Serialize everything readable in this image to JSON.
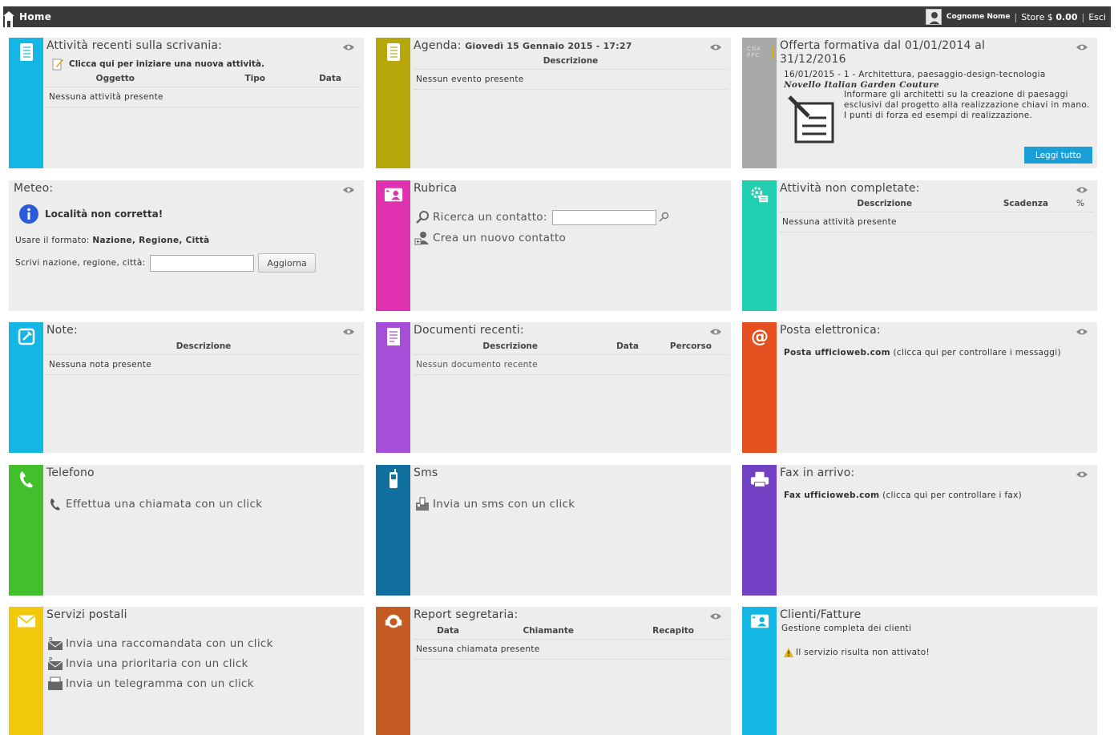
{
  "topbar": {
    "home": "Home",
    "user": "Cognome Nome",
    "store": "Store",
    "currency": "$",
    "balance": "0.00",
    "exit": "Esci"
  },
  "colors": {
    "topbar": "#3a3a3a",
    "cyan": "#14b6e3",
    "olive": "#b7a70a",
    "gray": "#a9a9a9",
    "magenta": "#e031b0",
    "teal": "#22cfb0",
    "purple": "#a64ed9",
    "orange": "#e4501f",
    "green": "#43bf2b",
    "darkblue": "#106f9f",
    "violet": "#7240c2",
    "yellow": "#f1c90a",
    "brown": "#c65a23"
  },
  "panels": {
    "attivita": {
      "title": "Attività recenti sulla scrivania:",
      "new_link": "Clicca qui per iniziare una nuova attività.",
      "headers": [
        "Oggetto",
        "Tipo",
        "Data"
      ],
      "empty": "Nessuna attività presente",
      "icon": "notebook-icon"
    },
    "agenda": {
      "title": "Agenda:",
      "datetime": "Giovedì 15 Gennaio 2015 - 17:27",
      "header": "Descrizione",
      "empty": "Nessun evento presente",
      "icon": "notebook-icon"
    },
    "offerta": {
      "title": "Offerta formativa dal 01/01/2014 al 31/12/2016",
      "course": "16/01/2015 - 1 - Architettura, paesaggio-design-tecnologia",
      "course_title": "Novello Italian Garden Couture",
      "description": "Informare gli architetti su la creazione di paesaggi esclusivi dal progetto alla realizzazione chiavi in mano. I punti di forza ed esempi di realizzazione.",
      "read_more": "Leggi tutto",
      "logo_text": "CNA PPC"
    },
    "meteo": {
      "title": "Meteo:",
      "error": "Località non corretta!",
      "format_label": "Usare il formato:",
      "format_value": "Nazione, Regione, Città",
      "input_label": "Scrivi nazione, regione, città:",
      "button": "Aggiorna"
    },
    "rubrica": {
      "title": "Rubrica",
      "search_label": "Ricerca un contatto:",
      "create": "Crea un nuovo contatto"
    },
    "nonCompletate": {
      "title": "Attività non completate:",
      "headers": [
        "Descrizione",
        "Scadenza",
        "%"
      ],
      "empty": "Nessuna attività presente"
    },
    "note": {
      "title": "Note:",
      "header": "Descrizione",
      "empty": "Nessuna nota presente"
    },
    "documenti": {
      "title": "Documenti recenti:",
      "headers": [
        "Descrizione",
        "Data",
        "Percorso"
      ],
      "empty": "Nessun documento recente"
    },
    "posta": {
      "title": "Posta elettronica:",
      "link": "Posta ufficioweb.com",
      "hint": "(clicca qui per controllare i messaggi)"
    },
    "telefono": {
      "title": "Telefono",
      "link": "Effettua una chiamata con un click"
    },
    "sms": {
      "title": "Sms",
      "link": "Invia un sms con un click"
    },
    "fax": {
      "title": "Fax in arrivo:",
      "link": "Fax ufficioweb.com",
      "hint": "(clicca qui per controllare i fax)"
    },
    "postali": {
      "title": "Servizi postali",
      "links": [
        "Invia una raccomandata con un click",
        "Invia una prioritaria con un click",
        "Invia un telegramma con un click"
      ]
    },
    "report": {
      "title": "Report segretaria:",
      "headers": [
        "Data",
        "Chiamante",
        "Recapito"
      ],
      "empty": "Nessuna chiamata presente"
    },
    "clienti": {
      "title": "Clienti/Fatture",
      "subtitle": "Gestione completa dei clienti",
      "warning": "Il servizio risulta non attivato!"
    }
  }
}
